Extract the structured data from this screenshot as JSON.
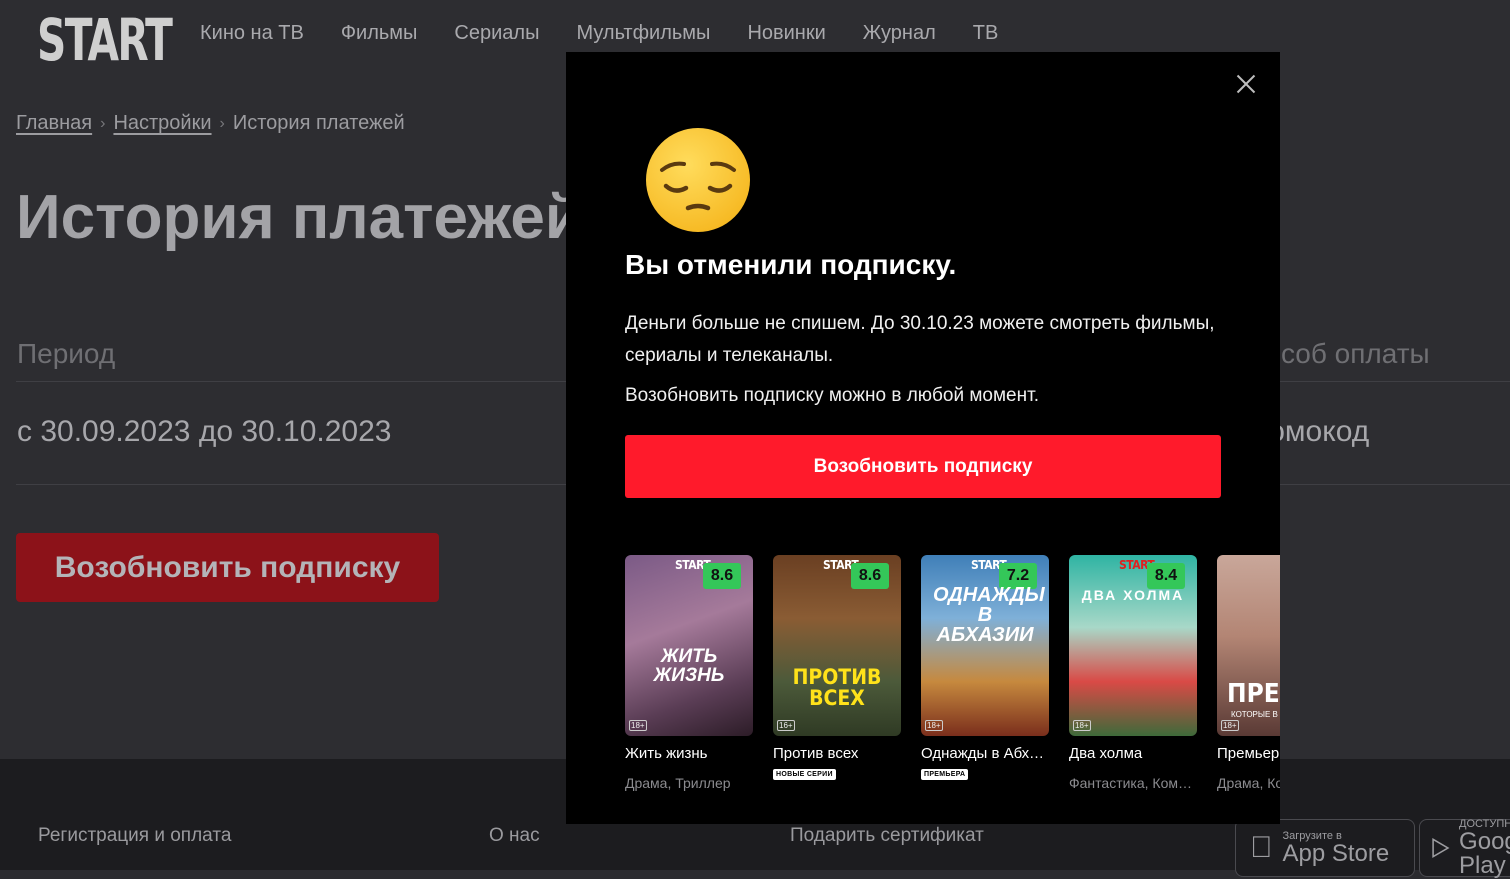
{
  "header": {
    "logo": "START",
    "nav": [
      "Кино на ТВ",
      "Фильмы",
      "Сериалы",
      "Мультфильмы",
      "Новинки",
      "Журнал",
      "ТВ"
    ]
  },
  "breadcrumbs": {
    "home": "Главная",
    "settings": "Настройки",
    "current": "История платежей"
  },
  "page_title": "История платежей",
  "table": {
    "col_period": "Период",
    "col_method": "Способ оплаты",
    "row_period": "с 30.09.2023 до 30.10.2023",
    "row_method": "Промокод"
  },
  "resume_button_bg": "Возобновить подписку",
  "footer": {
    "links": [
      "Регистрация и оплата",
      "О нас",
      "Подарить сертификат"
    ],
    "appstore_small": "Загрузите в",
    "appstore_big": "App Store",
    "gplay_small": "ДОСТУПНО В",
    "gplay_big": "Google Play"
  },
  "modal": {
    "emoji": "pensive-face",
    "title": "Вы отменили подписку.",
    "text1": "Деньги больше не спишем. До 30.10.23 можете смотреть фильмы, сериалы и телеканалы.",
    "text2": "Возобновить подписку можно в любой момент.",
    "button": "Возобновить подписку",
    "cards": [
      {
        "name": "Жить жизнь",
        "genre": "Драма, Триллер",
        "rating": "8.6",
        "age": "18+",
        "brand": "START",
        "poster_text": "ЖИТЬ ЖИЗНЬ"
      },
      {
        "name": "Против всех",
        "badge": "НОВЫЕ СЕРИИ",
        "rating": "8.6",
        "age": "16+",
        "brand": "START",
        "poster_text": "ПРОТИВ ВСЕХ"
      },
      {
        "name": "Однажды в Абхазии",
        "badge": "ПРЕМЬЕРА",
        "rating": "7.2",
        "age": "18+",
        "brand": "START",
        "poster_text": "ОДНАЖДЫ В АБХАЗИИ"
      },
      {
        "name": "Два холма",
        "genre": "Фантастика, Комедия",
        "rating": "8.4",
        "age": "18+",
        "brand": "START",
        "poster_text": "ДВА ХОЛМА"
      },
      {
        "name": "Премьер",
        "genre": "Драма, Комедия",
        "age": "18+",
        "poster_text": "ПРЕМЬЕР",
        "poster_subtext": "КОТОРЫЕ В"
      }
    ]
  },
  "colors": {
    "accent_red": "#ff1a2b",
    "rating_green": "#34c759",
    "modal_bg": "#000000"
  }
}
